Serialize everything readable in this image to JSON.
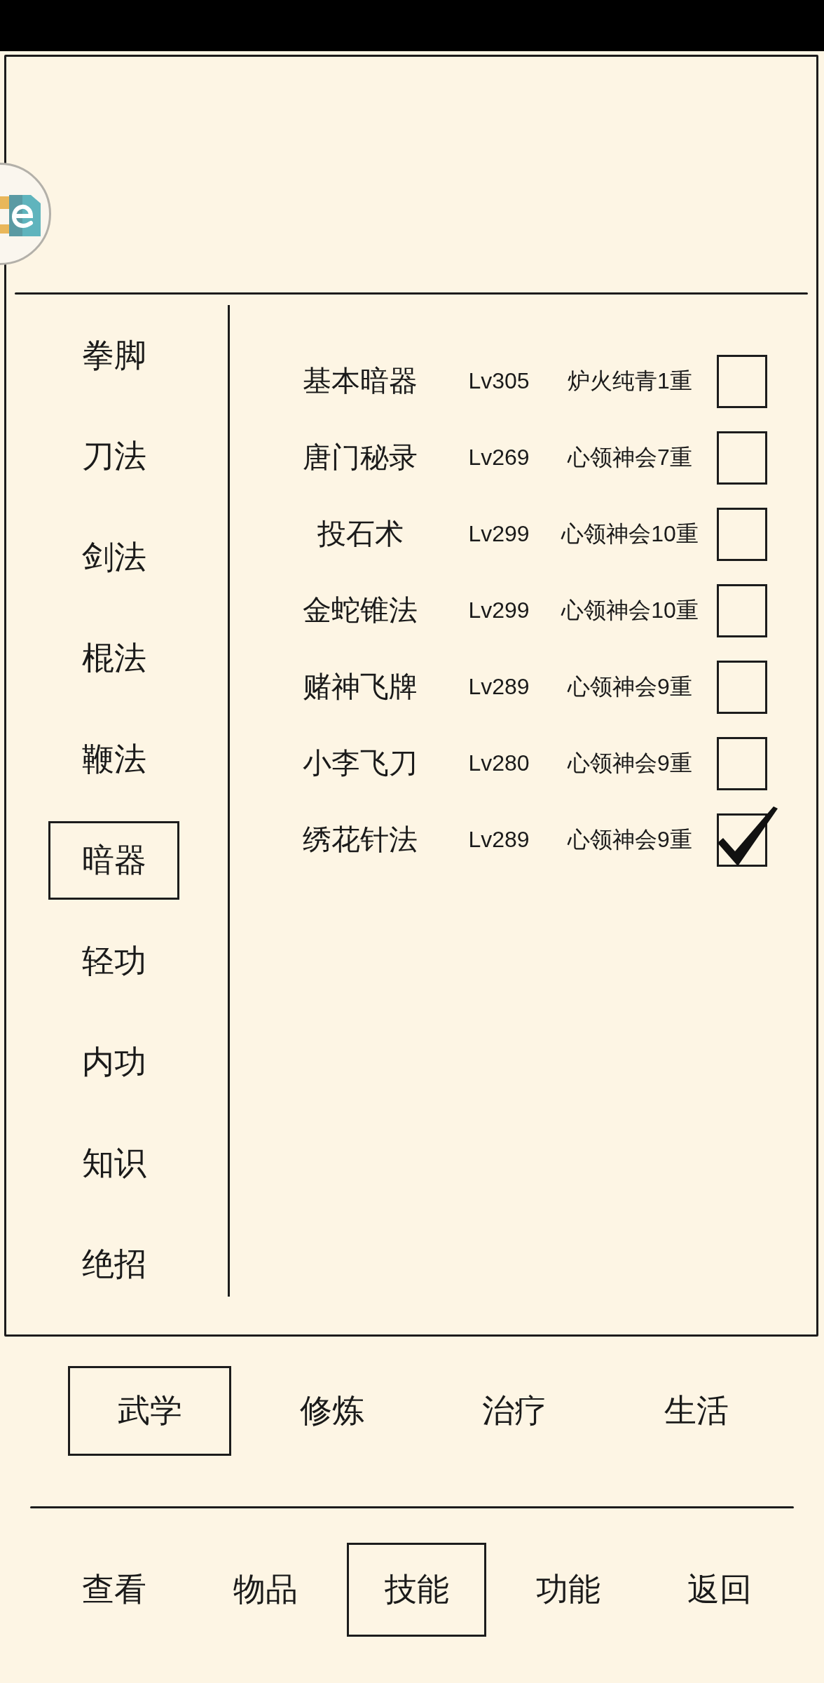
{
  "sidebar": {
    "items": [
      {
        "label": "拳脚",
        "selected": false
      },
      {
        "label": "刀法",
        "selected": false
      },
      {
        "label": "剑法",
        "selected": false
      },
      {
        "label": "棍法",
        "selected": false
      },
      {
        "label": "鞭法",
        "selected": false
      },
      {
        "label": "暗器",
        "selected": true
      },
      {
        "label": "轻功",
        "selected": false
      },
      {
        "label": "内功",
        "selected": false
      },
      {
        "label": "知识",
        "selected": false
      },
      {
        "label": "绝招",
        "selected": false
      }
    ]
  },
  "skills": [
    {
      "name": "基本暗器",
      "grade": "Lv305",
      "rank": "炉火纯青1重",
      "checked": false
    },
    {
      "name": "唐门秘录",
      "grade": "Lv269",
      "rank": "心领神会7重",
      "checked": false
    },
    {
      "name": "投石术",
      "grade": "Lv299",
      "rank": "心领神会10重",
      "checked": false
    },
    {
      "name": "金蛇锥法",
      "grade": "Lv299",
      "rank": "心领神会10重",
      "checked": false
    },
    {
      "name": "赌神飞牌",
      "grade": "Lv289",
      "rank": "心领神会9重",
      "checked": false
    },
    {
      "name": "小李飞刀",
      "grade": "Lv280",
      "rank": "心领神会9重",
      "checked": false
    },
    {
      "name": "绣花针法",
      "grade": "Lv289",
      "rank": "心领神会9重",
      "checked": true
    }
  ],
  "category_tabs": [
    {
      "label": "武学",
      "selected": true
    },
    {
      "label": "修炼",
      "selected": false
    },
    {
      "label": "治疗",
      "selected": false
    },
    {
      "label": "生活",
      "selected": false
    }
  ],
  "bottom_nav": [
    {
      "label": "查看",
      "selected": false
    },
    {
      "label": "物品",
      "selected": false
    },
    {
      "label": "技能",
      "selected": true
    },
    {
      "label": "功能",
      "selected": false
    },
    {
      "label": "返回",
      "selected": false
    }
  ]
}
